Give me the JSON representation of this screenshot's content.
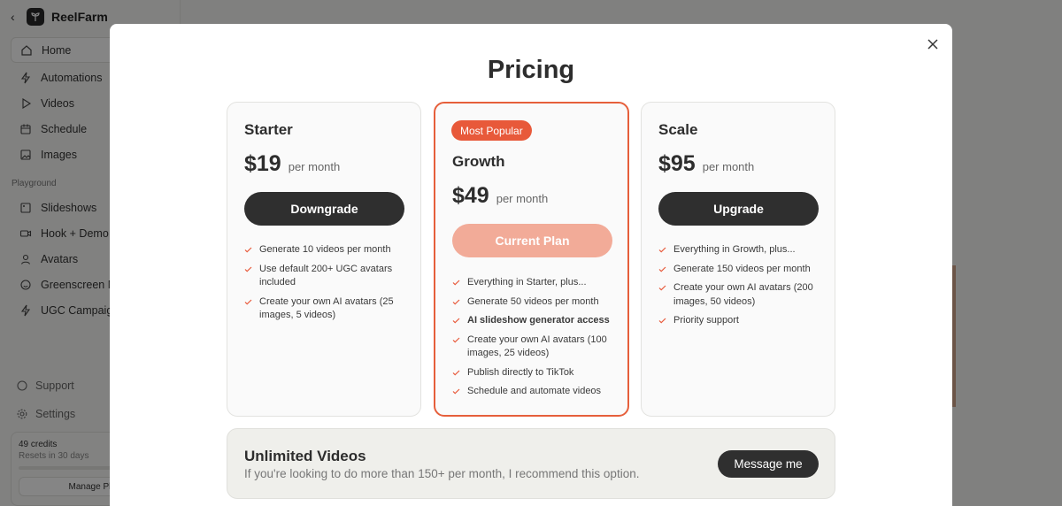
{
  "app": {
    "name": "ReelFarm",
    "nav": [
      {
        "label": "Home",
        "icon": "home-icon"
      },
      {
        "label": "Automations",
        "icon": "lightning-icon"
      },
      {
        "label": "Videos",
        "icon": "play-icon"
      },
      {
        "label": "Schedule",
        "icon": "calendar-icon"
      },
      {
        "label": "Images",
        "icon": "image-icon"
      }
    ],
    "playground_label": "Playground",
    "playground": [
      {
        "label": "Slideshows",
        "icon": "slides-icon"
      },
      {
        "label": "Hook + Demo",
        "icon": "video-icon"
      },
      {
        "label": "Avatars",
        "icon": "user-icon"
      },
      {
        "label": "Greenscreen Me",
        "icon": "smile-icon"
      },
      {
        "label": "UGC Campaigns",
        "icon": "lightning-icon"
      }
    ],
    "support_label": "Support",
    "settings_label": "Settings",
    "credits": "49 credits",
    "resets": "Resets in 30 days",
    "manage_plan": "Manage Plan"
  },
  "modal": {
    "title": "Pricing",
    "plans": [
      {
        "name": "Starter",
        "price": "$19",
        "period": "per month",
        "cta": "Downgrade",
        "features": [
          "Generate 10 videos per month",
          "Use default 200+ UGC avatars included",
          "Create your own AI avatars (25 images, 5 videos)"
        ]
      },
      {
        "badge": "Most Popular",
        "name": "Growth",
        "price": "$49",
        "period": "per month",
        "cta": "Current Plan",
        "features": [
          "Everything in Starter, plus...",
          "Generate 50 videos per month",
          "AI slideshow generator access",
          "Create your own AI avatars (100 images, 25 videos)",
          "Publish directly to TikTok",
          "Schedule and automate videos"
        ]
      },
      {
        "name": "Scale",
        "price": "$95",
        "period": "per month",
        "cta": "Upgrade",
        "features": [
          "Everything in Growth, plus...",
          "Generate 150 videos per month",
          "Create your own AI avatars (200 images, 50 videos)",
          "Priority support"
        ]
      }
    ],
    "unlimited": {
      "title": "Unlimited Videos",
      "subtitle": "If you're looking to do more than 150+ per month, I recommend this option.",
      "button": "Message me"
    }
  },
  "colors": {
    "accent": "#e8593a",
    "dark_button": "#2f2f2f",
    "current_plan": "#f2ab98"
  }
}
